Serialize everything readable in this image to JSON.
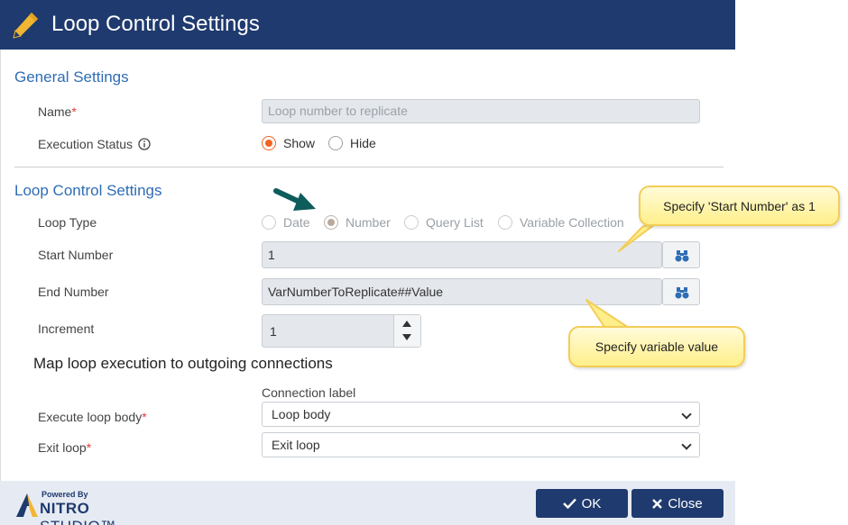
{
  "header": {
    "title": "Loop Control Settings",
    "icon": "pencil-icon"
  },
  "general": {
    "section_title": "General Settings",
    "name_label": "Name",
    "name_placeholder": "Loop number to replicate",
    "execution_status_label": "Execution Status",
    "execution_status_options": [
      "Show",
      "Hide"
    ],
    "execution_status_selected": "Show"
  },
  "loop_control": {
    "section_title": "Loop Control Settings",
    "loop_type_label": "Loop Type",
    "loop_type_options": [
      "Date",
      "Number",
      "Query List",
      "Variable Collection"
    ],
    "loop_type_selected": "Number",
    "start_number_label": "Start Number",
    "start_number_value": "1",
    "end_number_label": "End Number",
    "end_number_value": "VarNumberToReplicate##Value",
    "increment_label": "Increment",
    "increment_value": "1"
  },
  "mapping": {
    "heading": "Map loop execution to outgoing connections",
    "connection_label": "Connection label",
    "execute_body_label": "Execute loop body",
    "execute_body_value": "Loop body",
    "exit_loop_label": "Exit loop",
    "exit_loop_value": "Exit loop"
  },
  "callouts": {
    "start": "Specify 'Start Number' as 1",
    "variable": "Specify variable value"
  },
  "footer": {
    "powered_by": "Powered By",
    "brand_bold": "NITRO",
    "brand_rest": "STUDIO™",
    "ok_label": "OK",
    "close_label": "Close"
  },
  "colors": {
    "header_bg": "#1f3a6e",
    "accent_radio": "#f26322",
    "section_title": "#2f6db5",
    "callout_fill": "#ffef8a",
    "arrow": "#0f5c5c"
  }
}
